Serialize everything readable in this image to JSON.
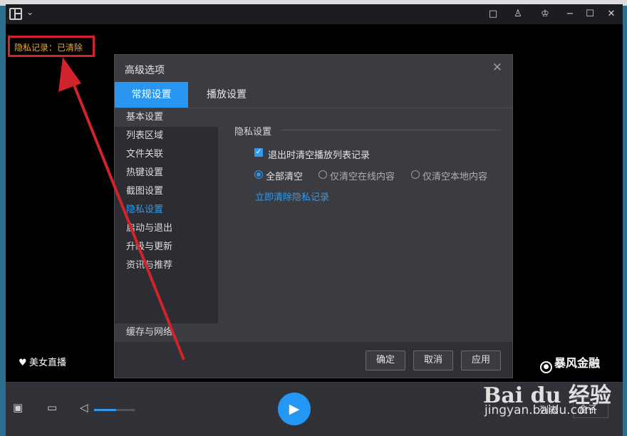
{
  "overlay": {
    "privacy_status": "隐私记录：已清除",
    "live_label": "美女直播",
    "brand_label": "暴风金融"
  },
  "titlebar": {
    "buttons": [
      "□",
      "♙",
      "♔",
      "−",
      "☐",
      "✕"
    ]
  },
  "dialog": {
    "title": "高级选项",
    "close": "✕",
    "tabs": [
      "常规设置",
      "播放设置"
    ],
    "nav": [
      "基本设置",
      "列表区域",
      "文件关联",
      "热键设置",
      "截图设置",
      "隐私设置",
      "启动与退出",
      "升级与更新",
      "资讯与推荐",
      "缓存与网络"
    ],
    "active_nav": "隐私设置",
    "section_title": "隐私设置",
    "checkbox_label": "退出时清空播放列表记录",
    "checkbox_checked": true,
    "radios": [
      "全部清空",
      "仅清空在线内容",
      "仅清空本地内容"
    ],
    "selected_radio": "全部清空",
    "clear_link": "立即清除隐私记录",
    "buttons": {
      "ok": "确定",
      "cancel": "取消",
      "apply": "应用"
    }
  },
  "controlbar": {
    "volume_level": 0.55,
    "list_label": "列表",
    "box_label": "盒子"
  },
  "watermark": {
    "logo": "Bai du 经验",
    "url": "jingyan.baidu.com"
  },
  "colors": {
    "accent": "#2e9bf0",
    "annotation": "#d0232b",
    "status_text": "#f3a928"
  }
}
